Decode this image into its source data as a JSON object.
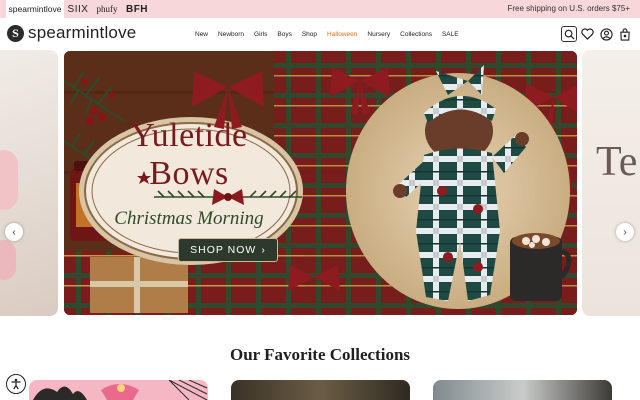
{
  "topbar": {
    "brand_tabs": [
      "spearmintlove",
      "SIIX",
      "phufy",
      "BFH"
    ],
    "promo": "Free shipping on U.S. orders $75+"
  },
  "header": {
    "logo_mark": "S",
    "logo_text": "spearmintlove",
    "nav": [
      "New",
      "Newborn",
      "Girls",
      "Boys",
      "Shop",
      "Halloween",
      "Nursery",
      "Collections",
      "SALE"
    ],
    "icons": [
      "search-icon",
      "heart-icon",
      "account-icon",
      "cart-icon"
    ]
  },
  "hero": {
    "title_line1": "Yuletide",
    "title_line2": "Bows",
    "subtitle": "Christmas Morning",
    "cta_label": "SHOP NOW",
    "cta_chevron": "›",
    "next_slide_peek": "Te",
    "arrow_prev": "‹",
    "arrow_next": "›"
  },
  "collections": {
    "title": "Our Favorite Collections"
  },
  "colors": {
    "topbar": "#f7d7da",
    "halloween_link": "#e0711c",
    "title_red": "#7a1a1e",
    "button_green": "#2d3a2b"
  }
}
